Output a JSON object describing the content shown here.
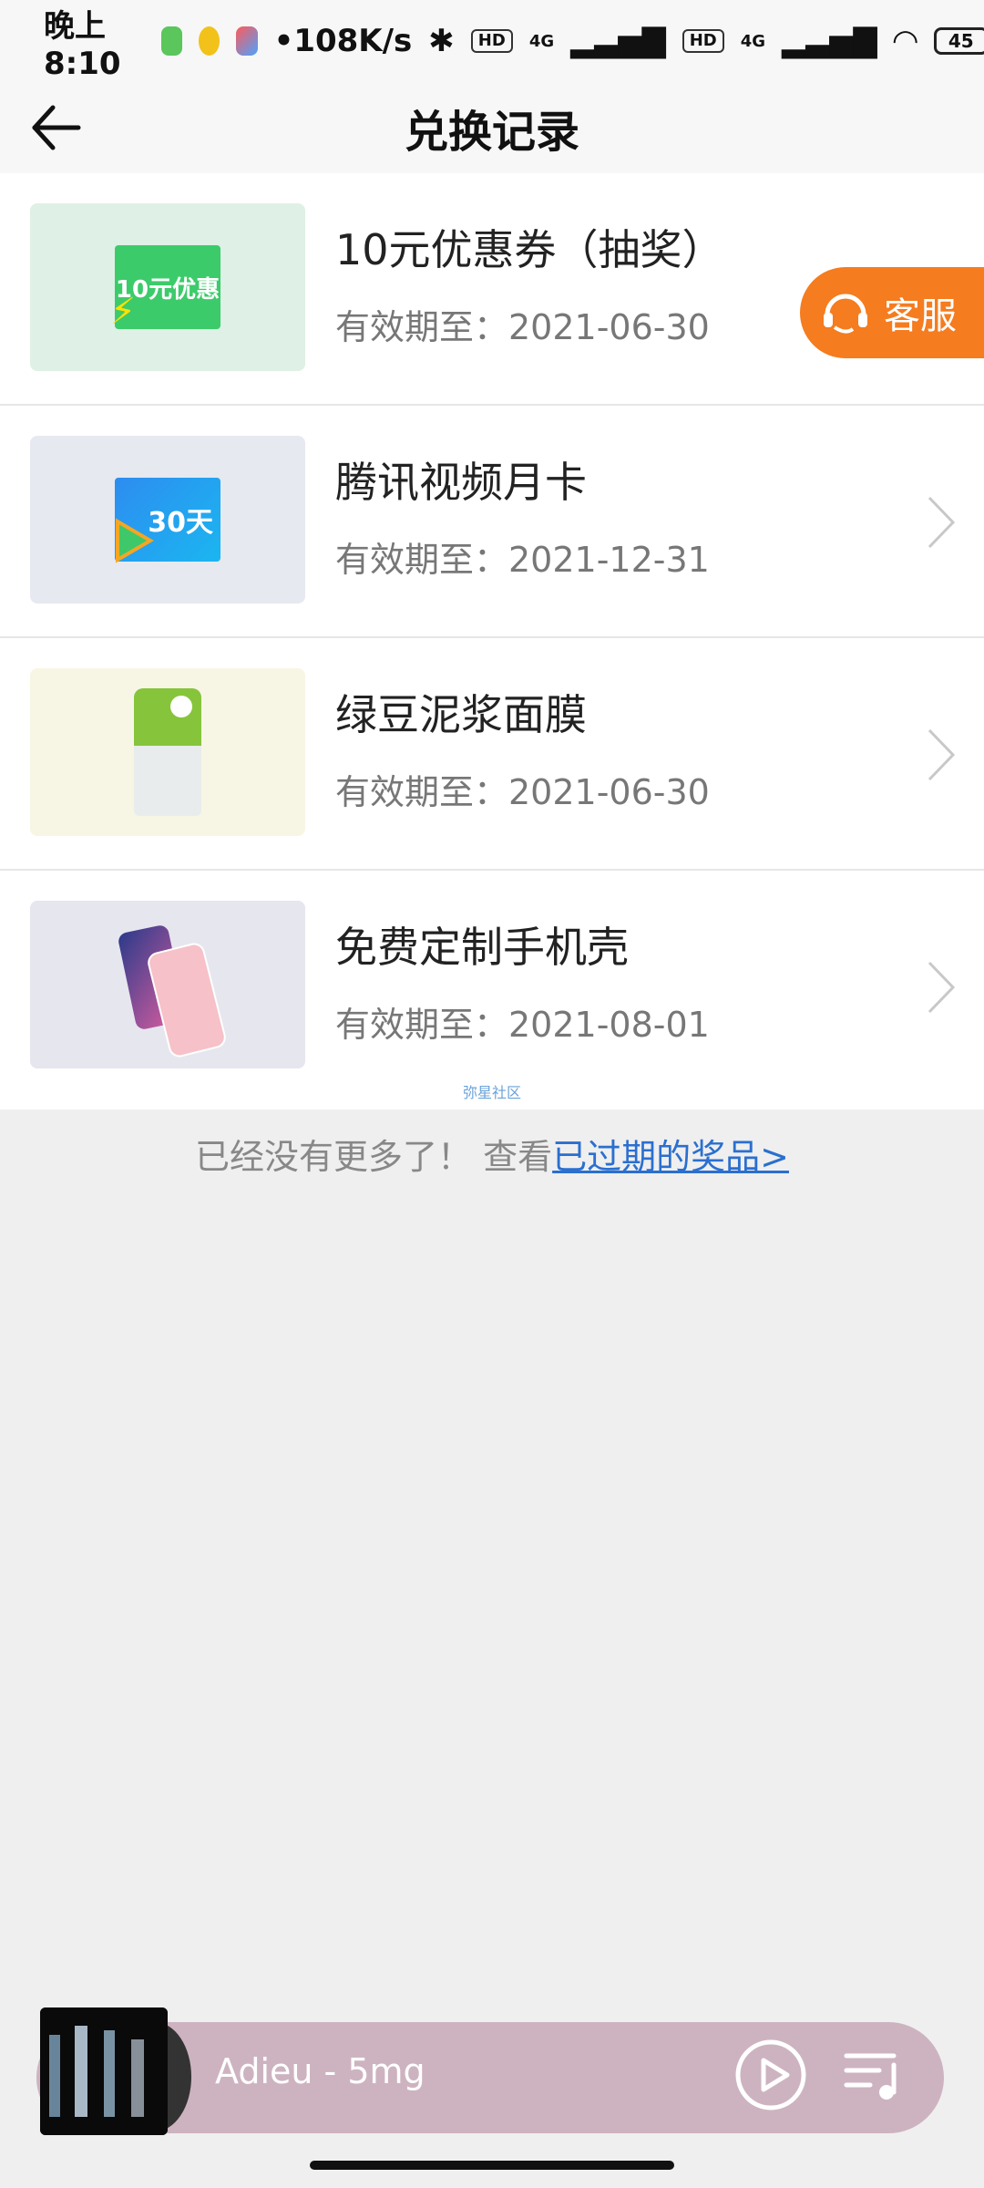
{
  "status_bar": {
    "time": "晚上8:10",
    "network_speed": "108K/s",
    "hd1": "HD",
    "hd2": "HD",
    "net1": "4G",
    "net2": "4G",
    "battery": "45"
  },
  "header": {
    "title": "兑换记录"
  },
  "items": [
    {
      "title": "10元优惠券（抽奖）",
      "date": "有效期至：2021-06-30",
      "thumb_text": "10元优惠"
    },
    {
      "title": "腾讯视频月卡",
      "date": "有效期至：2021-12-31",
      "thumb_text": "30天"
    },
    {
      "title": "绿豆泥浆面膜",
      "date": "有效期至：2021-06-30",
      "thumb_text": ""
    },
    {
      "title": "免费定制手机壳",
      "date": "有效期至：2021-08-01",
      "thumb_text": ""
    }
  ],
  "watermark": "弥星社区",
  "footer": {
    "text": "已经没有更多了！  查看",
    "link": "已过期的奖品>"
  },
  "service_button": {
    "label": "客服"
  },
  "player": {
    "song": "Adieu - 5mg"
  },
  "colors": {
    "accent_orange": "#f57c1f",
    "player_bg": "#cdb3c0",
    "link_blue": "#2b6fcf"
  }
}
